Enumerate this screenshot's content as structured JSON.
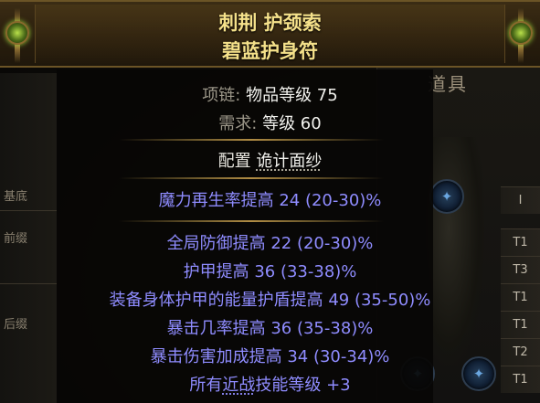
{
  "background": {
    "panel_title": "道具",
    "left_tags": [
      "基底",
      "前缀",
      "后缀"
    ],
    "tiers": [
      "I",
      "T1",
      "T3",
      "T1",
      "T1",
      "T2",
      "T1"
    ]
  },
  "item": {
    "name_line1": "刺荆 护颈索",
    "name_line2": "碧蓝护身符",
    "frame_color": "#f5e18a",
    "properties": [
      {
        "label": "项链: ",
        "value": "物品等级 75"
      },
      {
        "label": "需求: ",
        "value": "等级 60"
      }
    ],
    "enchant": {
      "prefix": "配置 ",
      "highlight": "诡计面纱"
    },
    "implicit": "魔力再生率提高 24 (20-30)%",
    "explicit": [
      "全局防御提高 22 (20-30)%",
      "护甲提高 36 (33-38)%",
      "装备身体护甲的能量护盾提高 49 (35-50)%",
      "暴击几率提高 36 (35-38)%",
      "暴击伤害加成提高 34 (30-34)%"
    ],
    "last_mod": {
      "prefix": "所有",
      "highlight": "近战",
      "suffix": "技能等级 +3"
    },
    "mod_color": "#8f8cff"
  }
}
